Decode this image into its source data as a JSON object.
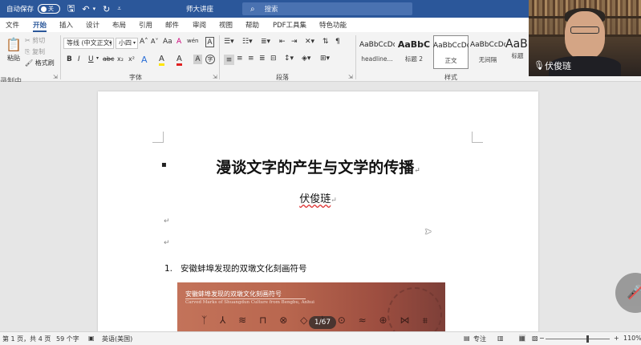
{
  "titlebar": {
    "autosave_label": "自动保存",
    "autosave_state": "关",
    "doc_title": "师大讲座",
    "search_placeholder": "搜索"
  },
  "tabs": [
    "文件",
    "开始",
    "插入",
    "设计",
    "布局",
    "引用",
    "邮件",
    "审阅",
    "视图",
    "帮助",
    "PDF工具集",
    "特色功能"
  ],
  "active_tab": "开始",
  "ribbon": {
    "clipboard": {
      "paste": "粘贴",
      "cut": "剪切",
      "copy": "复制",
      "format_painter": "格式刷"
    },
    "font": {
      "font_name": "等线 (中文正文)",
      "font_size": "小四",
      "group_label": "字体",
      "bold": "B",
      "italic": "I",
      "underline": "U",
      "strike": "abc",
      "subscript": "x₂",
      "superscript": "x²",
      "grow": "A˄",
      "shrink": "A˅",
      "case": "Aa",
      "clear": "A",
      "phonetic": "wén",
      "border": "A",
      "text_effect": "A",
      "highlight": "A",
      "font_color": "A",
      "char_shading": "A",
      "enclose": "字"
    },
    "paragraph": {
      "group_label": "段落"
    },
    "styles": {
      "group_label": "样式",
      "tiles": [
        {
          "sample": "AaBbCcDd",
          "name": "headline..."
        },
        {
          "sample": "AaBbC",
          "name": "标题 2"
        },
        {
          "sample": "AaBbCcDd",
          "name": "正文"
        },
        {
          "sample": "AaBbCcDd",
          "name": "无间隔"
        },
        {
          "sample": "AaB",
          "name": "标题"
        }
      ]
    }
  },
  "document": {
    "title": "漫谈文字的产生与文学的传播",
    "author": "伏俊琏",
    "list_number": "1.",
    "list_text": "安徽蚌埠发现的双墩文化刻画符号",
    "para_mark": "↵"
  },
  "slide": {
    "title": "安徽蚌埠发现的双墩文化刻画符号",
    "subtitle": "Carved Marks of Shuangdun Culture from Bengbu, Anhui",
    "page_indicator": "1/67",
    "glyphs": "ᛉ ⅄ ≋ ⊓ ⊗ ◇ ⌇ ⊙ ≈ ⊕ ⋈ ⩩"
  },
  "statusbar": {
    "page": "第 1 页，共 4 页",
    "words": "59 个字",
    "language": "英语(美国)",
    "focus": "专注",
    "zoom": "110%"
  },
  "webcam": {
    "name": "伏俊琏"
  },
  "recording_label": "录制中"
}
